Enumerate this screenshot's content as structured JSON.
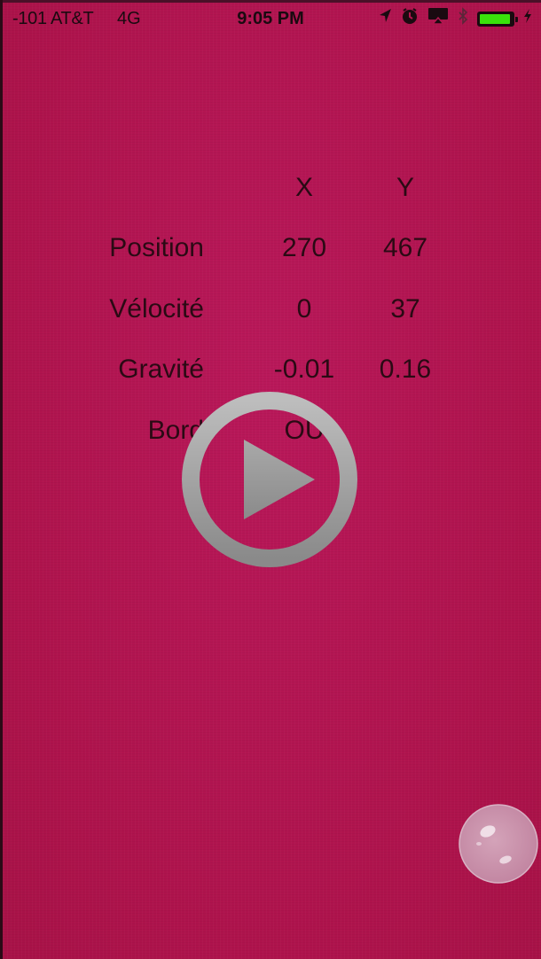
{
  "status_bar": {
    "carrier": "-101 AT&T",
    "network": "4G",
    "time": "9:05 PM",
    "battery_level": 0.95,
    "icons": [
      "location-arrow-icon",
      "alarm-clock-icon",
      "airplay-icon",
      "bluetooth-icon",
      "battery-icon",
      "charging-bolt-icon"
    ]
  },
  "table": {
    "headers": {
      "x": "X",
      "y": "Y"
    },
    "rows": [
      {
        "label": "Position",
        "x": "270",
        "y": "467"
      },
      {
        "label": "Vélocité",
        "x": "0",
        "y": "37"
      },
      {
        "label": "Gravité",
        "x": "-0.01",
        "y": "0.16"
      },
      {
        "label": "Bord",
        "x": "OU",
        "y": ""
      }
    ]
  },
  "colors": {
    "background": "#b3154f",
    "text": "#2a0a14",
    "battery_fill": "#3ae20b",
    "play_button": "#8e8e8e"
  }
}
